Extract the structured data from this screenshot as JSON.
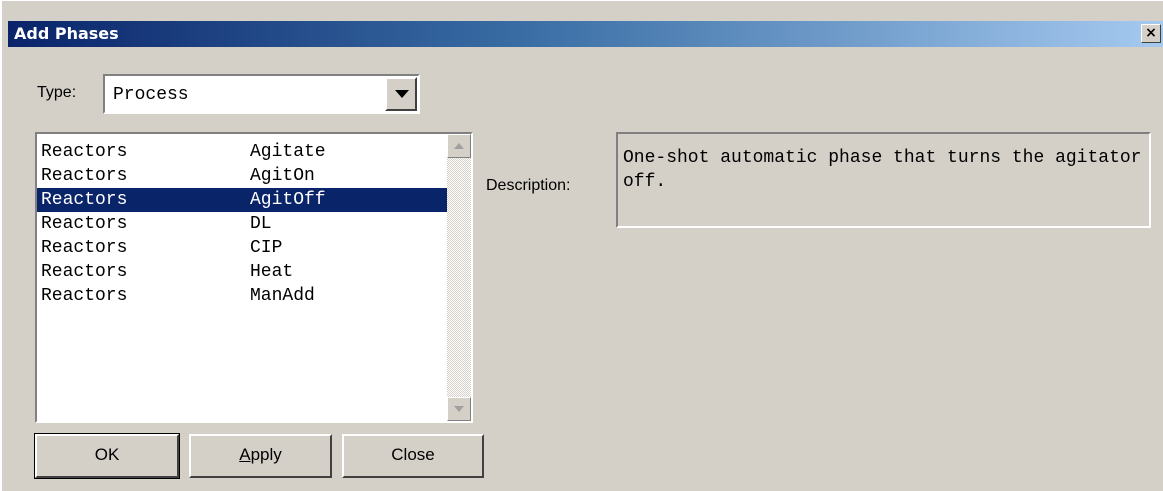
{
  "window": {
    "title": "Add Phases",
    "close_label": "×"
  },
  "type_field": {
    "label": "Type:",
    "value": "Process"
  },
  "phase_list": {
    "rows": [
      {
        "area": "Reactors",
        "phase": "Agitate",
        "selected": false
      },
      {
        "area": "Reactors",
        "phase": "AgitOn",
        "selected": false
      },
      {
        "area": "Reactors",
        "phase": "AgitOff",
        "selected": true
      },
      {
        "area": "Reactors",
        "phase": "DL",
        "selected": false
      },
      {
        "area": "Reactors",
        "phase": "CIP",
        "selected": false
      },
      {
        "area": "Reactors",
        "phase": "Heat",
        "selected": false
      },
      {
        "area": "Reactors",
        "phase": "ManAdd",
        "selected": false
      }
    ]
  },
  "description": {
    "label": "Description:",
    "text": "One-shot automatic phase that turns the agitator off."
  },
  "buttons": {
    "ok": "OK",
    "apply_accel": "A",
    "apply_rest": "pply",
    "close": "Close"
  },
  "colors": {
    "selection": "#0a246a",
    "title_start": "#0a246a",
    "title_end": "#a6caf0",
    "face": "#d4d0c8"
  }
}
